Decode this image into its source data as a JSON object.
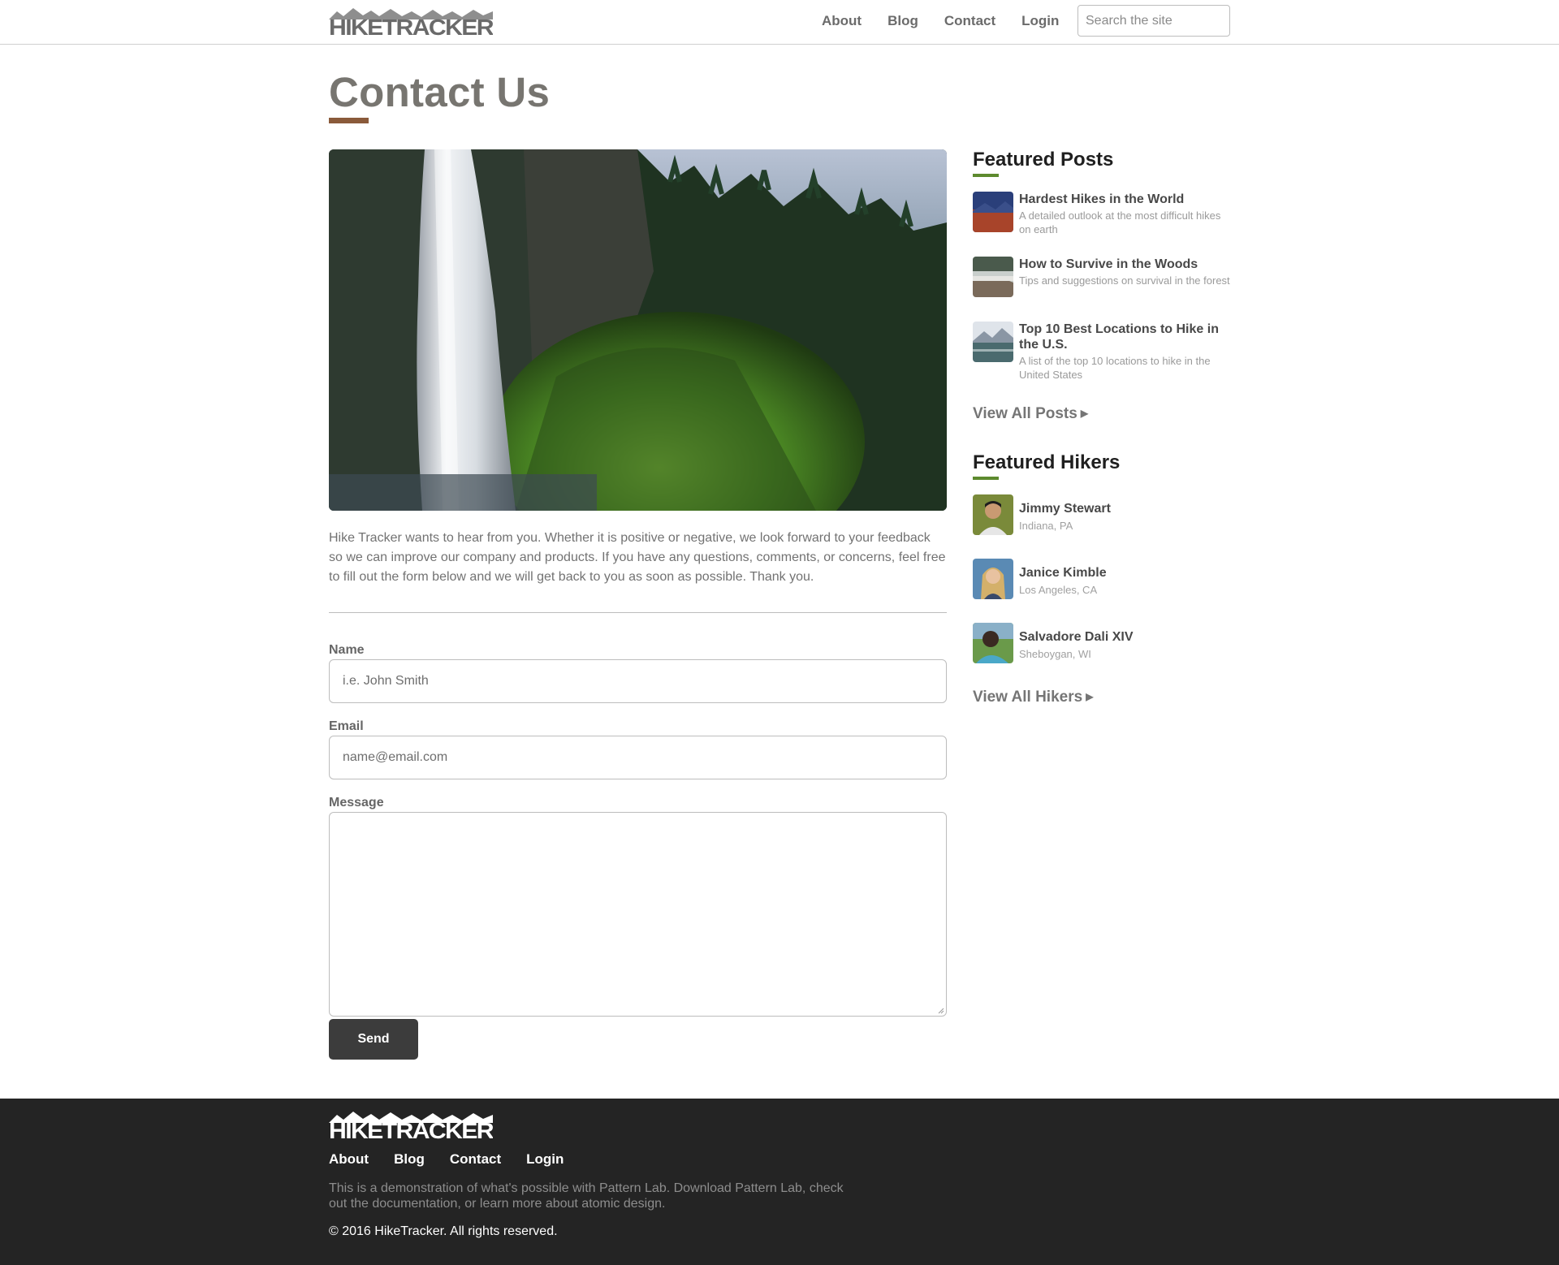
{
  "brand": {
    "name": "HIKETRACKER"
  },
  "header": {
    "nav": [
      "About",
      "Blog",
      "Contact",
      "Login"
    ],
    "search_placeholder": "Search the site"
  },
  "page": {
    "title": "Contact Us",
    "intro": "Hike Tracker wants to hear from you. Whether it is positive or negative, we look forward to your feedback so we can improve our company and products. If you have any questions, comments, or concerns, feel free to fill out the form below and we will get back to you as soon as possible. Thank you."
  },
  "form": {
    "name_label": "Name",
    "name_placeholder": "i.e. John Smith",
    "email_label": "Email",
    "email_placeholder": "name@email.com",
    "message_label": "Message",
    "send_label": "Send"
  },
  "sidebar": {
    "posts_heading": "Featured Posts",
    "posts": [
      {
        "title": "Hardest Hikes in the World",
        "desc": "A detailed outlook at the most difficult hikes on earth"
      },
      {
        "title": "How to Survive in the Woods",
        "desc": "Tips and suggestions on survival in the forest"
      },
      {
        "title": "Top 10 Best Locations to Hike in the U.S.",
        "desc": "A list of the top 10 locations to hike in the United States"
      }
    ],
    "view_all_posts": "View All Posts",
    "hikers_heading": "Featured Hikers",
    "hikers": [
      {
        "name": "Jimmy Stewart",
        "location": "Indiana, PA"
      },
      {
        "name": "Janice Kimble",
        "location": "Los Angeles, CA"
      },
      {
        "name": "Salvadore Dali XIV",
        "location": "Sheboygan, WI"
      }
    ],
    "view_all_hikers": "View All Hikers"
  },
  "footer": {
    "nav": [
      "About",
      "Blog",
      "Contact",
      "Login"
    ],
    "description": "This is a demonstration of what's possible with Pattern Lab. Download Pattern Lab, check out the documentation, or learn more about atomic design.",
    "copyright": "© 2016 HikeTracker. All rights reserved."
  },
  "colors": {
    "title_accent": "#8a5a3a",
    "sidebar_accent": "#5d8a2e",
    "button": "#3c3c3c",
    "footer_bg": "#242424"
  }
}
